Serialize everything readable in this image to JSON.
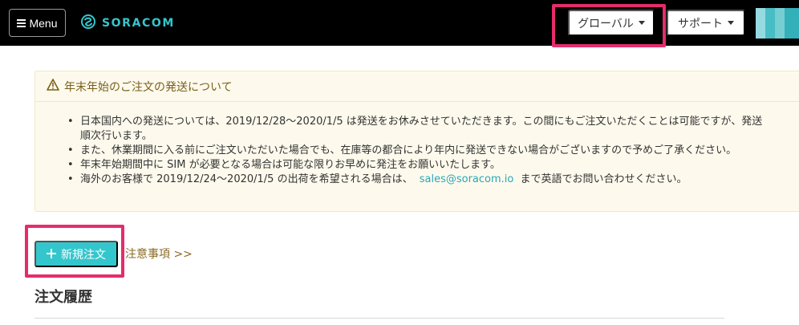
{
  "header": {
    "menu_label": "Menu",
    "logo_text": "SORACOM",
    "global_label": "グローバル",
    "support_label": "サポート"
  },
  "notice": {
    "title": "年末年始のご注文の発送について",
    "items": [
      {
        "line1": "日本国内への発送については、2019/12/28〜2020/1/5 は発送をお休みさせていただきます。この間にもご注文いただくことは可能ですが、発送",
        "line2": "順次行います。"
      },
      {
        "line1": "また、休業期間に入る前にご注文いただいた場合でも、在庫等の都合により年内に発送できない場合がございますので予めご了承ください。"
      },
      {
        "line1": "年末年始期間中に SIM が必要となる場合は可能な限りお早めに発注をお願いいたします。"
      },
      {
        "prefix": "海外のお客様で 2019/12/24〜2020/1/5 の出荷を希望される場合は、",
        "email": "sales@soracom.io",
        "suffix": "まで英語でお問い合わせください。"
      }
    ]
  },
  "actions": {
    "new_order_label": "新規注文",
    "notes_link_label": "注意事項 >>"
  },
  "history": {
    "title": "注文履歴"
  },
  "icons": [
    "menu-icon",
    "soracom-logo-icon",
    "caret-down-icon",
    "warning-icon",
    "plus-icon"
  ],
  "colors": {
    "accent": "#34c6cd",
    "highlight": "#e52c6d",
    "notice_background": "#fdfaed",
    "notice_text": "#7a5e1a"
  }
}
